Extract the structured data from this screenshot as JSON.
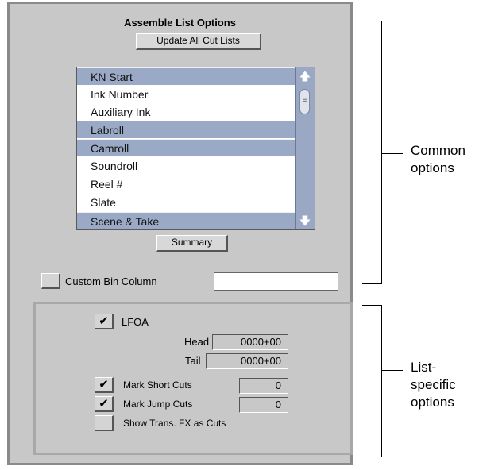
{
  "panel": {
    "title": "Assemble List Options",
    "update_button": "Update All Cut Lists",
    "summary_button": "Summary"
  },
  "list": {
    "items": [
      {
        "label": "KN Start",
        "selected": true
      },
      {
        "label": "Ink Number",
        "selected": false
      },
      {
        "label": "Auxiliary Ink",
        "selected": false
      },
      {
        "label": "Labroll",
        "selected": true
      },
      {
        "label": "Camroll",
        "selected": true
      },
      {
        "label": "Soundroll",
        "selected": false
      },
      {
        "label": "Reel #",
        "selected": false
      },
      {
        "label": "Slate",
        "selected": false
      },
      {
        "label": "Scene & Take",
        "selected": true
      }
    ],
    "up_arrow": "🡅",
    "down_arrow": "🡇",
    "thumb_glyph": "≡"
  },
  "custom_bin": {
    "label": "Custom Bin Column",
    "value": "",
    "checked": false
  },
  "list_specific": {
    "lfoa": {
      "label": "LFOA",
      "checked": true
    },
    "head": {
      "label": "Head",
      "value": "0000+00"
    },
    "tail": {
      "label": "Tail",
      "value": "0000+00"
    },
    "mark_short": {
      "label": "Mark Short Cuts",
      "checked": true,
      "value": "0"
    },
    "mark_jump": {
      "label": "Mark Jump Cuts",
      "checked": true,
      "value": "0"
    },
    "show_trans": {
      "label": "Show Trans. FX as Cuts",
      "checked": false
    }
  },
  "annotations": {
    "common_line1": "Common",
    "common_line2": "options",
    "list_line1": "List-",
    "list_line2": "specific",
    "list_line3": "options"
  },
  "checkmark": "✔"
}
